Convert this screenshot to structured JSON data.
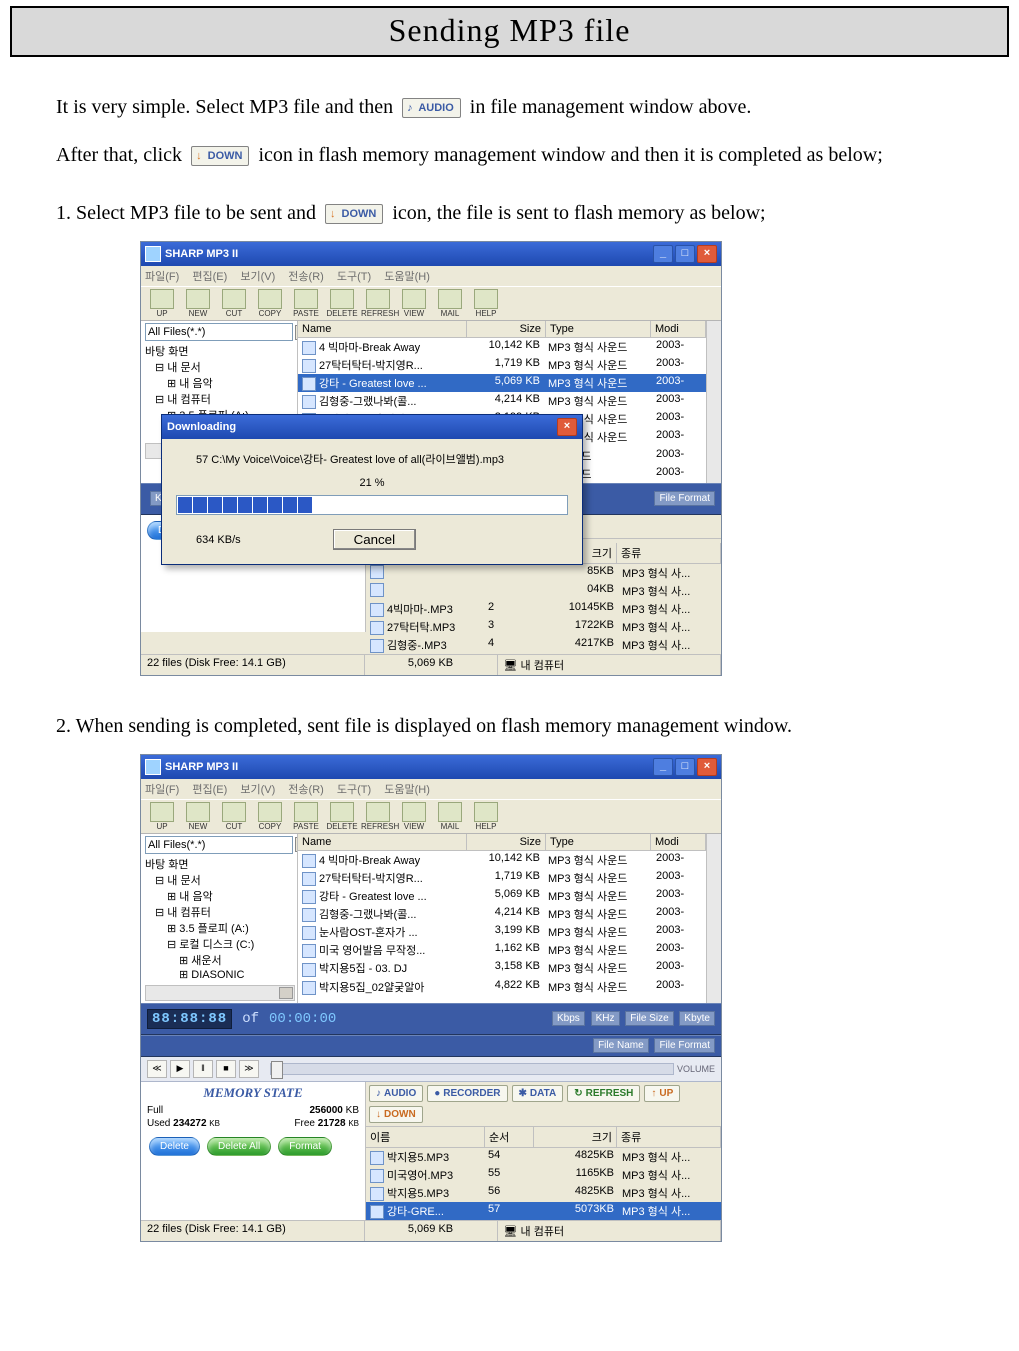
{
  "title": "Sending MP3 file",
  "text": {
    "intro1_a": "It is very simple. Select MP3 file and then ",
    "intro1_b": " in file management window above.",
    "intro2_a": "After that, click ",
    "intro2_b": "icon in flash memory management window and then it is completed as below;",
    "step1_a": "1. Select MP3 file to be sent and ",
    "step1_b": " icon, the file is sent to flash memory as below;",
    "step2": "2. When sending is completed, sent file is displayed on flash memory management window."
  },
  "chips": {
    "audio": "AUDIO",
    "down": "DOWN"
  },
  "app": {
    "title": "SHARP MP3 II",
    "menu": [
      "파일(F)",
      "편집(E)",
      "보기(V)",
      "전송(R)",
      "도구(T)",
      "도움말(H)"
    ],
    "toolbar": [
      "UP",
      "NEW",
      "CUT",
      "COPY",
      "PASTE",
      "DELETE",
      "REFRESH",
      "VIEW",
      "MAIL",
      "HELP"
    ],
    "filter": "All Files(*.*)",
    "tree1": [
      "바탕 화면",
      "내 문서",
      "내 음악",
      "내 컴퓨터",
      "3.5 플로피 (A:)",
      "로컬 디스크 (C:)"
    ],
    "tree2": [
      "바탕 화면",
      "내 문서",
      "내 음악",
      "내 컴퓨터",
      "3.5 플로피 (A:)",
      "로컬 디스크 (C:)",
      "새운서",
      "DIASONIC"
    ],
    "filehead": {
      "name": "Name",
      "size": "Size",
      "type": "Type",
      "mod": "Modi"
    },
    "files": [
      {
        "n": "4 빅마마-Break Away",
        "s": "10,142 KB",
        "t": "MP3 형식 사운드",
        "m": "2003-"
      },
      {
        "n": "27탁터탁터-박지영R...",
        "s": "1,719 KB",
        "t": "MP3 형식 사운드",
        "m": "2003-"
      },
      {
        "n": "강타 - Greatest love ...",
        "s": "5,069 KB",
        "t": "MP3 형식 사운드",
        "m": "2003-",
        "sel": true
      },
      {
        "n": "김형중-그랬나봐(콜...",
        "s": "4,214 KB",
        "t": "MP3 형식 사운드",
        "m": "2003-"
      },
      {
        "n": "눈사람OST-혼자가 ...",
        "s": "3,199 KB",
        "t": "MP3 형식 사운드",
        "m": "2003-"
      },
      {
        "n": "미국 영어발음 무작정...",
        "s": "1,162 KB",
        "t": "MP3 형식 사운드",
        "m": "2003-"
      },
      {
        "n": "",
        "s": "",
        "t": "식 사운드",
        "m": "2003-"
      },
      {
        "n": "",
        "s": "",
        "t": "식 사운드",
        "m": "2003-"
      }
    ],
    "files2": [
      {
        "n": "4 빅마마-Break Away",
        "s": "10,142 KB",
        "t": "MP3 형식 사운드",
        "m": "2003-"
      },
      {
        "n": "27탁터탁터-박지영R...",
        "s": "1,719 KB",
        "t": "MP3 형식 사운드",
        "m": "2003-"
      },
      {
        "n": "강타 - Greatest love ...",
        "s": "5,069 KB",
        "t": "MP3 형식 사운드",
        "m": "2003-"
      },
      {
        "n": "김형중-그랬나봐(콜...",
        "s": "4,214 KB",
        "t": "MP3 형식 사운드",
        "m": "2003-"
      },
      {
        "n": "눈사람OST-혼자가 ...",
        "s": "3,199 KB",
        "t": "MP3 형식 사운드",
        "m": "2003-"
      },
      {
        "n": "미국 영어발음 무작정...",
        "s": "1,162 KB",
        "t": "MP3 형식 사운드",
        "m": "2003-"
      },
      {
        "n": "박지용5집 - 03. DJ",
        "s": "3,158 KB",
        "t": "MP3 형식 사운드",
        "m": "2003-"
      },
      {
        "n": "박지용5집_02얄궂알아",
        "s": "4,822 KB",
        "t": "MP3 형식 사운드",
        "m": "2003-"
      }
    ],
    "mid": {
      "time_a": "88:88:88",
      "of": " of ",
      "time_b": "00:00:00",
      "labels": [
        "Kbps",
        "KHz",
        "File Size",
        "Kbyte",
        "File Name",
        "File Format",
        "VOLUME"
      ]
    },
    "transport": [
      "≪",
      "▶",
      "‖",
      "■",
      "≫"
    ],
    "memstate": {
      "hdr": "MEMORY STATE",
      "full_label": "Full",
      "full_val": "256000",
      "unit": "KB",
      "used_label": "Used",
      "used_val": "234272",
      "free_label": "Free",
      "free_val": "21728",
      "btn_delete": "Delete",
      "btn_deleteall": "Delete All",
      "btn_format": "Format"
    },
    "chips2": {
      "audio": "AUDIO",
      "recorder": "RECORDER",
      "data": "DATA",
      "refresh": "REFRESH",
      "up": "UP",
      "down": "DOWN"
    },
    "memhead": {
      "name": "이름",
      "ord": "순서",
      "size": "크기",
      "kind": "종류"
    },
    "memfiles1": [
      {
        "n": "",
        "o": "",
        "s": "85KB",
        "k": "MP3 형식 사..."
      },
      {
        "n": "",
        "o": "",
        "s": "04KB",
        "k": "MP3 형식 사..."
      },
      {
        "n": "4빅마마-.MP3",
        "o": "2",
        "s": "10145KB",
        "k": "MP3 형식 사..."
      },
      {
        "n": "27탁터탁.MP3",
        "o": "3",
        "s": "1722KB",
        "k": "MP3 형식 사..."
      },
      {
        "n": "김형중-.MP3",
        "o": "4",
        "s": "4217KB",
        "k": "MP3 형식 사..."
      }
    ],
    "memfiles2": [
      {
        "n": "박지용5.MP3",
        "o": "54",
        "s": "4825KB",
        "k": "MP3 형식 사..."
      },
      {
        "n": "미국영어.MP3",
        "o": "55",
        "s": "1165KB",
        "k": "MP3 형식 사..."
      },
      {
        "n": "박지용5.MP3",
        "o": "56",
        "s": "4825KB",
        "k": "MP3 형식 사..."
      },
      {
        "n": "강타-GRE...",
        "o": "57",
        "s": "5073KB",
        "k": "MP3 형식 사...",
        "sel": true
      }
    ],
    "status": {
      "left": "22 files (Disk Free: 14.1 GB)",
      "mid": "5,069 KB",
      "right": "내 컴퓨터"
    }
  },
  "dialog": {
    "title": "Downloading",
    "path": "57   C:\\My Voice\\Voice\\강타- Greatest love of all(라이브앨범).mp3",
    "pct": "21 %",
    "segs": 9,
    "rate": "634 KB/s",
    "cancel": "Cancel"
  }
}
